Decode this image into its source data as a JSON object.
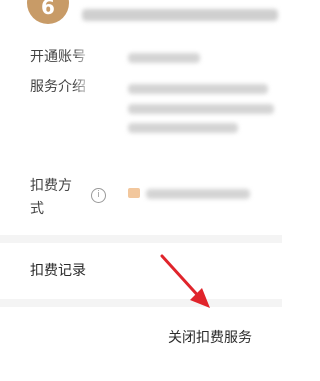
{
  "merchant": {
    "logo_char": "6",
    "logo_color": "#c89b67"
  },
  "fields": {
    "account_label": "开通账号",
    "service_label": "服务介绍",
    "pay_method_label_line1": "扣费方",
    "pay_method_label_line2": "式"
  },
  "info_icon": "i",
  "rows": {
    "record_label": "扣费记录"
  },
  "actions": {
    "close_label": "关闭扣费服务"
  },
  "annotation": {
    "arrow_color": "#e0242b"
  }
}
